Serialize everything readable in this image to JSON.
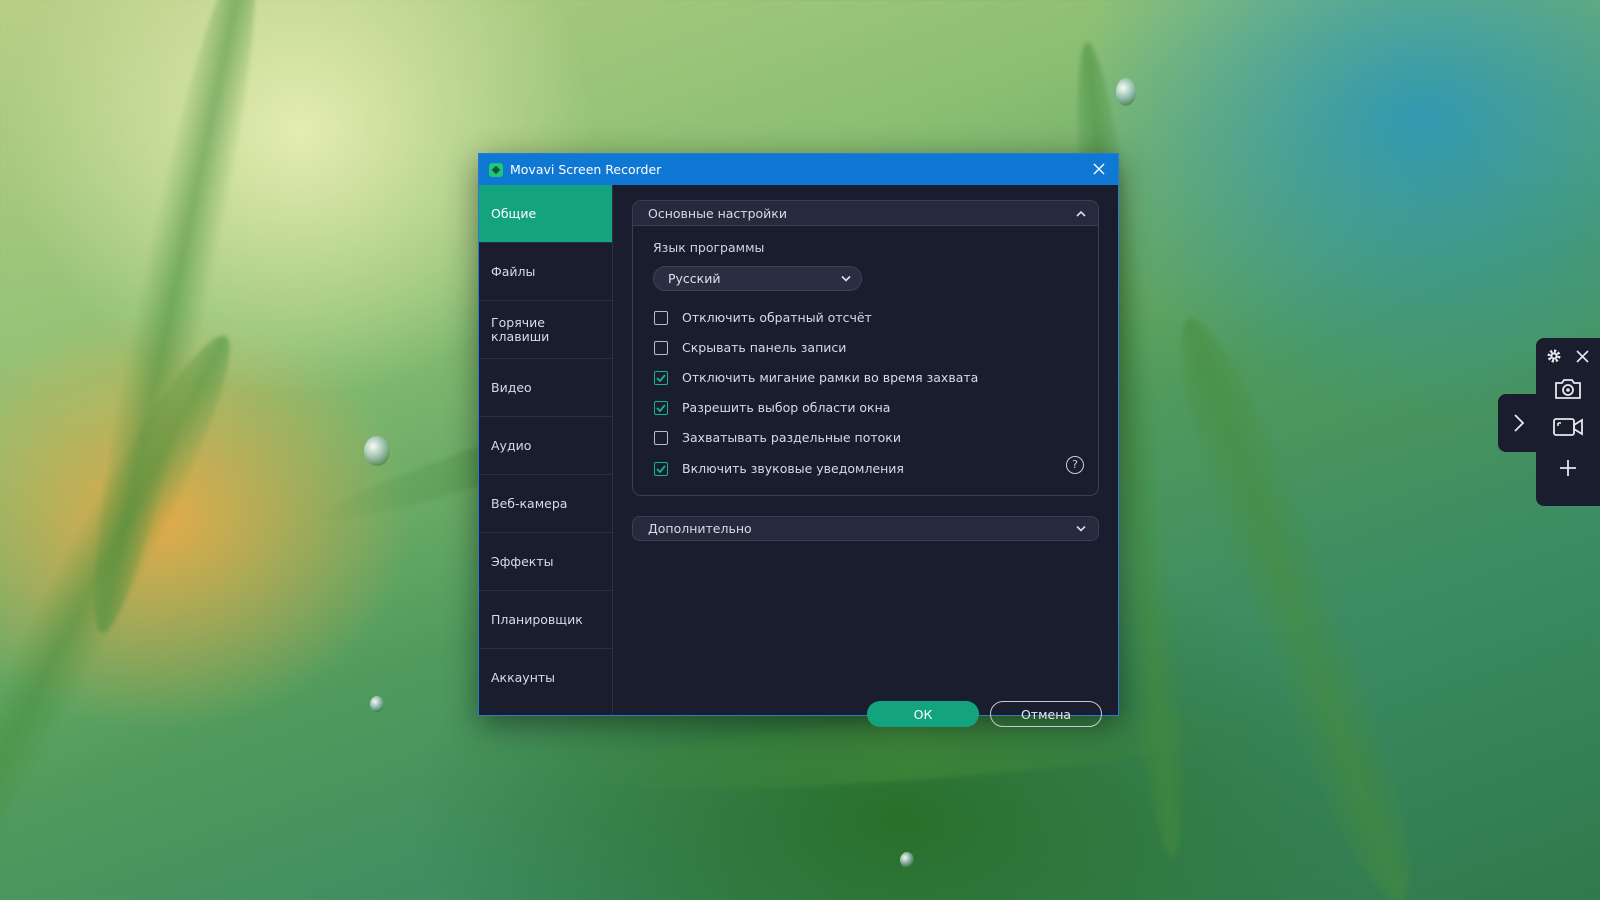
{
  "window": {
    "title": "Movavi Screen Recorder"
  },
  "sidebar": {
    "items": [
      {
        "label": "Общие",
        "active": true
      },
      {
        "label": "Файлы",
        "active": false
      },
      {
        "label": "Горячие клавиши",
        "active": false
      },
      {
        "label": "Видео",
        "active": false
      },
      {
        "label": "Аудио",
        "active": false
      },
      {
        "label": "Веб-камера",
        "active": false
      },
      {
        "label": "Эффекты",
        "active": false
      },
      {
        "label": "Планировщик",
        "active": false
      },
      {
        "label": "Аккаунты",
        "active": false
      }
    ]
  },
  "main_settings": {
    "title": "Основные настройки",
    "expanded": true,
    "language_label": "Язык программы",
    "language_value": "Русский",
    "options": [
      {
        "label": "Отключить обратный отсчёт",
        "checked": false
      },
      {
        "label": "Скрывать панель записи",
        "checked": false
      },
      {
        "label": "Отключить мигание рамки во время захвата",
        "checked": true
      },
      {
        "label": "Разрешить выбор области окна",
        "checked": true
      },
      {
        "label": "Захватывать раздельные потоки",
        "checked": false
      },
      {
        "label": "Включить звуковые уведомления",
        "checked": true
      }
    ],
    "help_glyph": "?"
  },
  "advanced": {
    "title": "Дополнительно",
    "expanded": false
  },
  "buttons": {
    "ok": "ОК",
    "cancel": "Отмена"
  },
  "recorder_panel": {
    "icons": [
      "gear-icon",
      "close-icon",
      "camera-icon",
      "video-capture-icon",
      "plus-icon",
      "chevron-right-icon"
    ]
  },
  "colors": {
    "accent": "#13a37f",
    "titlebar": "#0f78d4",
    "window_bg": "#1a1d2d",
    "section_header_bg": "#262a3c"
  }
}
